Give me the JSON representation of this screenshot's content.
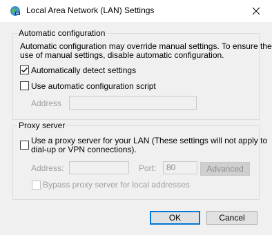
{
  "window": {
    "title": "Local Area Network (LAN) Settings"
  },
  "auto_config": {
    "group_label": "Automatic configuration",
    "description_line1": "Automatic configuration may override manual settings.  To ensure the",
    "description_line2": "use of manual settings, disable automatic configuration.",
    "auto_detect_label": "Automatically detect settings",
    "auto_detect_checked": true,
    "script_label": "Use automatic configuration script",
    "script_checked": false,
    "address_label": "Address",
    "address_value": ""
  },
  "proxy": {
    "group_label": "Proxy server",
    "use_proxy_label_line1": "Use a proxy server for your LAN (These settings will not apply to",
    "use_proxy_label_line2": "dial-up or VPN connections).",
    "use_proxy_checked": false,
    "address_label": "Address:",
    "address_value": "",
    "port_label": "Port:",
    "port_value": "80",
    "advanced_label": "Advanced",
    "bypass_label": "Bypass proxy server for local addresses",
    "bypass_checked": false
  },
  "buttons": {
    "ok_label": "OK",
    "cancel_label": "Cancel"
  },
  "colors": {
    "accent": "#0078d7",
    "disabled_text": "#a0a0a0",
    "background": "#f0f0f0"
  }
}
